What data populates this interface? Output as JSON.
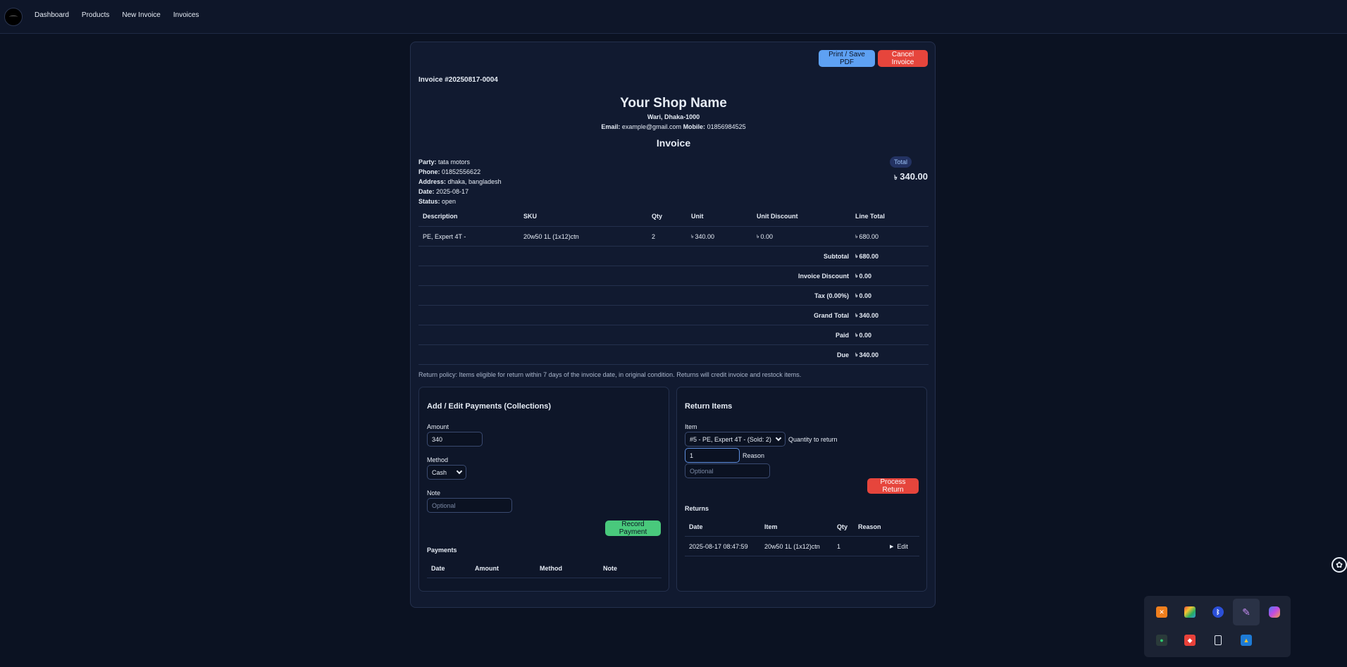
{
  "nav": {
    "links": [
      "Dashboard",
      "Products",
      "New Invoice",
      "Invoices"
    ]
  },
  "actions": {
    "print": "Print / Save PDF",
    "cancel": "Cancel Invoice"
  },
  "invoice": {
    "number": "Invoice #20250817-0004",
    "shop_name": "Your Shop Name",
    "shop_address": "Wari, Dhaka-1000",
    "email_label": "Email:",
    "email": "example@gmail.com",
    "mobile_label": "Mobile:",
    "mobile": "01856984525",
    "title": "Invoice",
    "total_badge": "Total",
    "currency": "৳",
    "total": "340.00"
  },
  "party": {
    "party_label": "Party:",
    "party": "tata motors",
    "phone_label": "Phone:",
    "phone": "01852556622",
    "address_label": "Address:",
    "address": "dhaka, bangladesh",
    "date_label": "Date:",
    "date": "2025-08-17",
    "status_label": "Status:",
    "status": "open"
  },
  "items_table": {
    "headers": [
      "Description",
      "SKU",
      "Qty",
      "Unit",
      "Unit Discount",
      "Line Total"
    ],
    "rows": [
      {
        "description": "PE, Expert 4T -",
        "sku": "20w50 1L (1x12)ctn",
        "qty": "2",
        "unit": "340.00",
        "unit_discount": "0.00",
        "line_total": "680.00"
      }
    ]
  },
  "summary": [
    {
      "label": "Subtotal",
      "value": "680.00"
    },
    {
      "label": "Invoice Discount",
      "value": "0.00"
    },
    {
      "label": "Tax (0.00%)",
      "value": "0.00"
    },
    {
      "label": "Grand Total",
      "value": "340.00"
    },
    {
      "label": "Paid",
      "value": "0.00"
    },
    {
      "label": "Due",
      "value": "340.00"
    }
  ],
  "policy": "Return policy: Items eligible for return within 7 days of the invoice date, in original condition. Returns will credit invoice and restock items.",
  "payments_panel": {
    "title": "Add / Edit Payments (Collections)",
    "amount_label": "Amount",
    "amount_value": "340",
    "method_label": "Method",
    "method_value": "Cash",
    "note_label": "Note",
    "note_placeholder": "Optional",
    "record_button": "Record Payment",
    "payments_heading": "Payments",
    "payments_headers": [
      "Date",
      "Amount",
      "Method",
      "Note"
    ]
  },
  "returns_panel": {
    "title": "Return Items",
    "item_label": "Item",
    "item_value": "#5 - PE, Expert 4T - (Sold: 2)",
    "qty_label": "Quantity to return",
    "qty_value": "1",
    "reason_label": "Reason",
    "reason_placeholder": "Optional",
    "process_button": "Process Return",
    "returns_heading": "Returns",
    "returns_headers": [
      "Date",
      "Item",
      "Qty",
      "Reason"
    ],
    "returns_rows": [
      {
        "date": "2025-08-17 08:47:59",
        "item": "20w50 1L (1x12)ctn",
        "qty": "1",
        "reason": "",
        "edit": "Edit"
      }
    ]
  },
  "tray": {
    "icons": [
      "xampp-icon",
      "photos-icon",
      "bluetooth-icon",
      "pen-icon",
      "copilot-icon",
      "network-icon",
      "anydesk-icon",
      "usb-drive-icon",
      "security-warning-icon"
    ]
  },
  "colors": {
    "background": "#0b1222",
    "card": "#111a30",
    "primary": "#5ea1f3",
    "danger": "#e6453c",
    "success": "#49c97c"
  }
}
